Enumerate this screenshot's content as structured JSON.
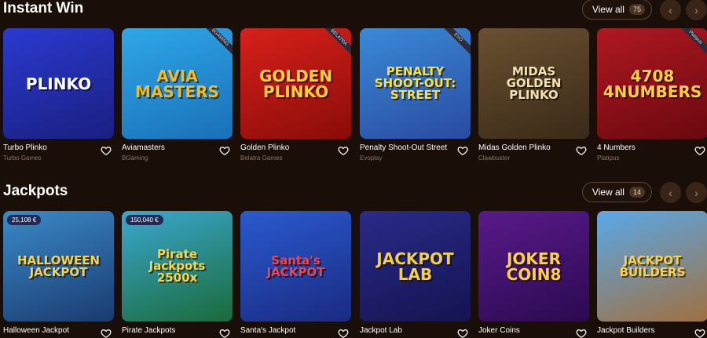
{
  "sections": [
    {
      "title": "Instant Win",
      "view_all_label": "View all",
      "count": "75",
      "games": [
        {
          "name": "Turbo Plinko",
          "provider": "Turbo Games",
          "art": "PLINKO",
          "bg": "#2a3ad0",
          "bg2": "#1a1f80",
          "fg": "#ffffff",
          "tag": ""
        },
        {
          "name": "Aviamasters",
          "provider": "BGaming",
          "art": "AVIA MASTERS",
          "bg": "#2ea8e8",
          "bg2": "#1a6fb8",
          "fg": "#f5b820",
          "tag": "BGAMING"
        },
        {
          "name": "Golden Plinko",
          "provider": "Belatra Games",
          "art": "GOLDEN PLINKO",
          "bg": "#d8201a",
          "bg2": "#8a0c08",
          "fg": "#ffd23a",
          "tag": "BELATRA"
        },
        {
          "name": "Penalty Shoot-Out Street",
          "provider": "Evoplay",
          "art": "PENALTY SHOOT-OUT: STREET",
          "bg": "#3a8ad8",
          "bg2": "#2a4aa0",
          "fg": "#ffe03a",
          "tag": "EVO"
        },
        {
          "name": "Midas Golden Plinko",
          "provider": "Clawbuster",
          "art": "MIDAS GOLDEN PLINKO",
          "bg": "#6a5030",
          "bg2": "#3a2a18",
          "fg": "#f4e0b0",
          "tag": ""
        },
        {
          "name": "4 Numbers",
          "provider": "Platipus",
          "art": "4708 4NUMBERS",
          "bg": "#b01820",
          "bg2": "#6a0810",
          "fg": "#ffd040",
          "tag": "Platipus"
        }
      ]
    },
    {
      "title": "Jackpots",
      "view_all_label": "View all",
      "count": "14",
      "games": [
        {
          "name": "Halloween Jackpot",
          "provider": "",
          "art": "HALLOWEEN JACKPOT",
          "bg": "#3a8ac8",
          "bg2": "#1a3a70",
          "fg": "#ffd040",
          "tag": "",
          "jackpot": "25,108 €"
        },
        {
          "name": "Pirate Jackpots",
          "provider": "",
          "art": "Pirate Jackpots 2500x",
          "bg": "#3aa8d0",
          "bg2": "#1a6a3a",
          "fg": "#ffd040",
          "tag": "",
          "jackpot": "150,040 €"
        },
        {
          "name": "Santa's Jackpot",
          "provider": "",
          "art": "Santa's JACKPOT",
          "bg": "#2a5ad0",
          "bg2": "#1a2a80",
          "fg": "#ff4040",
          "tag": "",
          "jackpot": ""
        },
        {
          "name": "Jackpot Lab",
          "provider": "",
          "art": "JACKPOT LAB",
          "bg": "#2a2a8a",
          "bg2": "#141450",
          "fg": "#f5d040",
          "tag": "",
          "jackpot": ""
        },
        {
          "name": "Joker Coins",
          "provider": "",
          "art": "JOKER COIN8",
          "bg": "#5a1a8a",
          "bg2": "#2a0a50",
          "fg": "#ffd040",
          "tag": "",
          "jackpot": ""
        },
        {
          "name": "Jackpot Builders",
          "provider": "",
          "art": "JACKPOT BUILDERS",
          "bg": "#5aa8e8",
          "bg2": "#a07040",
          "fg": "#ffd040",
          "tag": "",
          "jackpot": ""
        }
      ]
    }
  ],
  "colors": {
    "background": "#1a0e08",
    "accent": "#3a2418",
    "muted_text": "#8a7565"
  },
  "icons": {
    "heart": "heart-icon",
    "prev": "chevron-left-icon",
    "next": "chevron-right-icon"
  }
}
